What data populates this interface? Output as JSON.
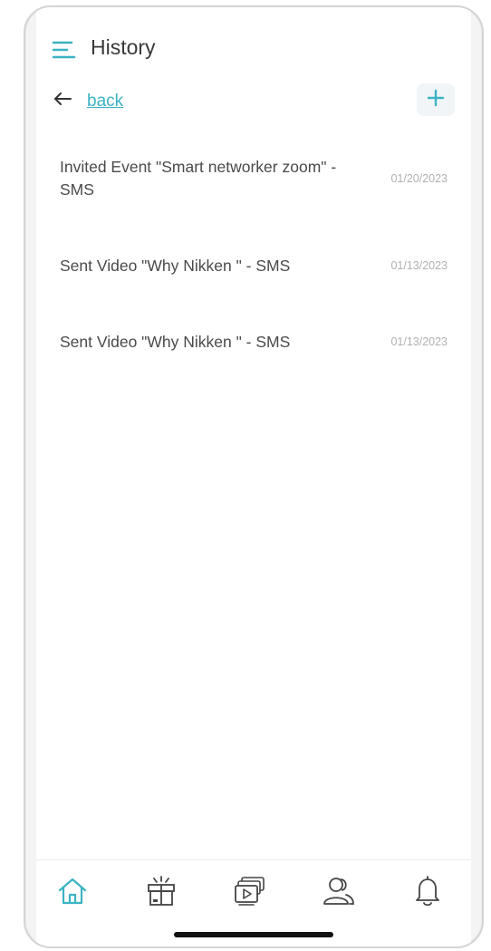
{
  "header": {
    "title": "History",
    "menu_icon": "menu-icon"
  },
  "nav_actions": {
    "back_label": "back",
    "back_icon": "arrow-left-icon",
    "add_icon": "plus-icon"
  },
  "history": [
    {
      "text": "Invited Event \"Smart networker zoom\" - SMS",
      "date": "01/20/2023"
    },
    {
      "text": "Sent Video \"Why Nikken \" - SMS",
      "date": "01/13/2023"
    },
    {
      "text": "Sent Video \"Why Nikken \" - SMS",
      "date": "01/13/2023"
    }
  ],
  "bottom_nav": [
    {
      "name": "home",
      "icon": "home-icon",
      "active": true
    },
    {
      "name": "gift",
      "icon": "gift-icon",
      "active": false
    },
    {
      "name": "videos",
      "icon": "video-library-icon",
      "active": false
    },
    {
      "name": "contacts",
      "icon": "users-icon",
      "active": false
    },
    {
      "name": "notifications",
      "icon": "bell-icon",
      "active": false
    }
  ],
  "colors": {
    "accent": "#3bb3c3",
    "text": "#4a4a4a",
    "muted": "#b0b0b0",
    "icon_gray": "#444444"
  }
}
